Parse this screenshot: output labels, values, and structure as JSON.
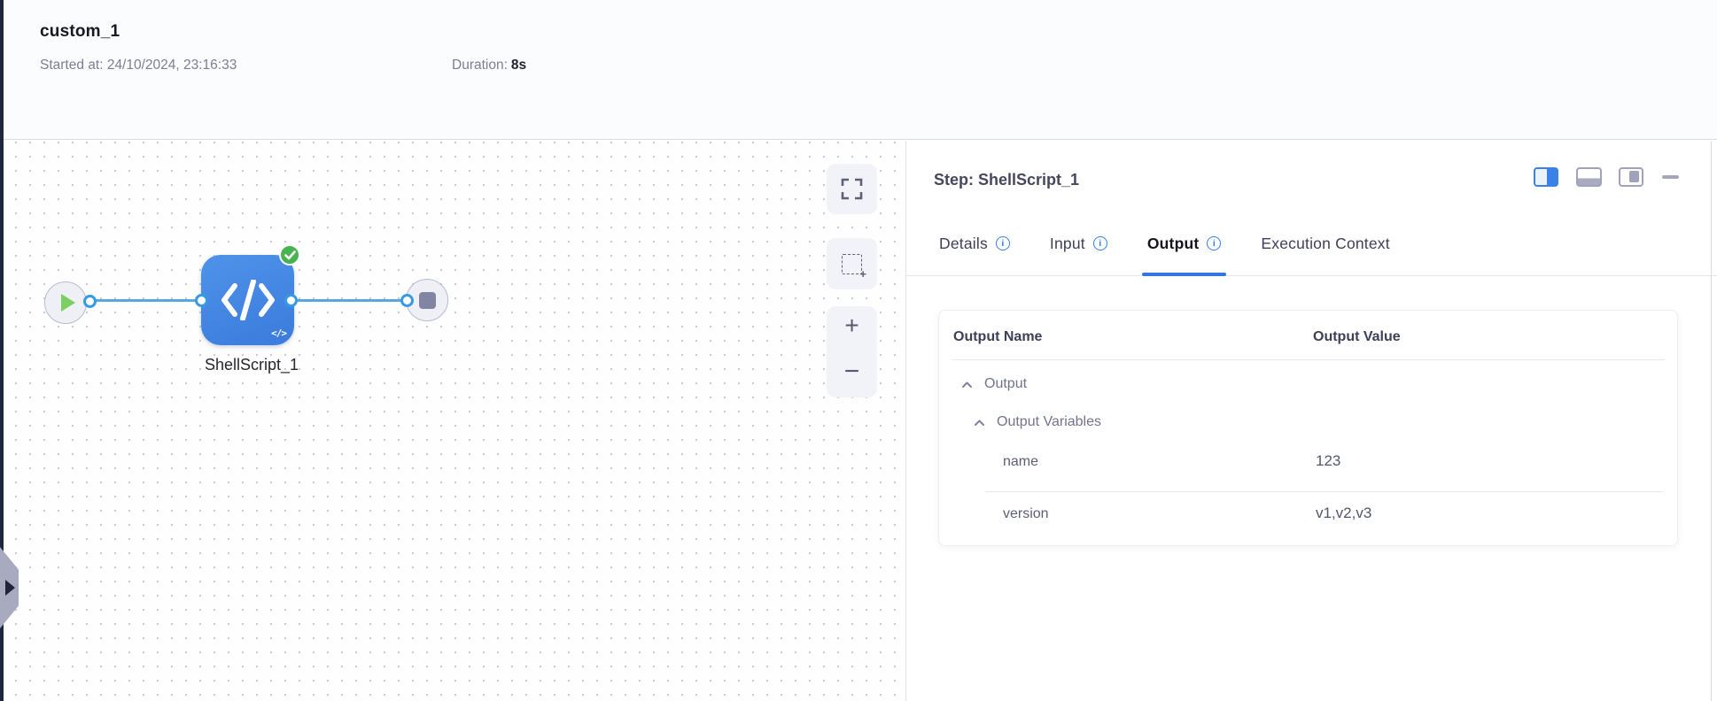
{
  "header": {
    "title": "custom_1",
    "started": "Started at: 24/10/2024, 23:16:33",
    "duration_label": "Duration:",
    "duration_value": "8s"
  },
  "canvas": {
    "node_label": "ShellScript_1",
    "zoom_in_glyph": "+",
    "zoom_out_glyph": "−",
    "marquee_plus_glyph": "+",
    "code_badge_glyph": "</>"
  },
  "panel": {
    "title": "Step: ShellScript_1",
    "info_glyph": "i",
    "tabs": [
      {
        "label": "Details",
        "info": true
      },
      {
        "label": "Input",
        "info": true
      },
      {
        "label": "Output",
        "info": true,
        "active": true
      },
      {
        "label": "Execution Context",
        "info": false
      }
    ],
    "table": {
      "col_name": "Output Name",
      "col_value": "Output Value",
      "rows": [
        {
          "type": "group",
          "indent": 0,
          "label": "Output",
          "value": ""
        },
        {
          "type": "group",
          "indent": 1,
          "label": "Output Variables",
          "value": ""
        },
        {
          "type": "leaf",
          "indent": 2,
          "label": "name",
          "value": "123"
        },
        {
          "type": "leaf",
          "indent": 2,
          "label": "version",
          "value": "v1,v2,v3"
        }
      ]
    }
  },
  "colors": {
    "accent_blue": "#2f7de2",
    "node_blue": "#3e82e2",
    "edge_blue": "#58a7e2",
    "success_green": "#49b34f",
    "dark_strip": "#202639"
  }
}
